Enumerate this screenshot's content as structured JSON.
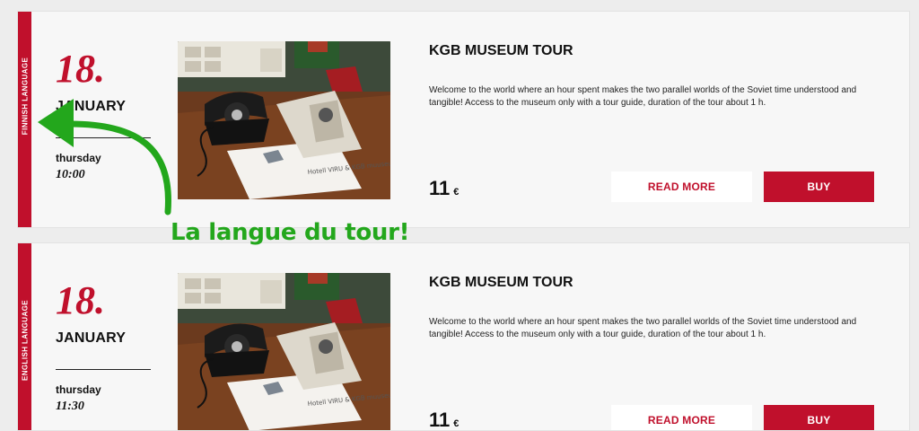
{
  "colors": {
    "accent": "#c0102c",
    "annotation": "#23a71c",
    "card_bg": "#f7f7f7"
  },
  "tours": [
    {
      "language": "FINNISH LANGUAGE",
      "day": "18.",
      "month": "JANUARY",
      "weekday": "thursday",
      "time": "10:00",
      "title": "KGB MUSEUM TOUR",
      "description": "Welcome to the world where an hour spent makes the two parallel worlds of the Soviet time understood and tangible! Access to the museum only with a tour guide, duration of the tour about 1 h.",
      "price": "11",
      "currency": "€",
      "read_more": "READ MORE",
      "buy": "BUY",
      "photo_caption": "Hotell VIRU & KGB muuseum"
    },
    {
      "language": "ENGLISH LANGUAGE",
      "day": "18.",
      "month": "JANUARY",
      "weekday": "thursday",
      "time": "11:30",
      "title": "KGB MUSEUM TOUR",
      "description": "Welcome to the world where an hour spent makes the two parallel worlds of the Soviet time understood and tangible! Access to the museum only with a tour guide, duration of the tour about 1 h.",
      "price": "11",
      "currency": "€",
      "read_more": "READ MORE",
      "buy": "BUY",
      "photo_caption": "Hotell VIRU & KGB muuseum"
    }
  ],
  "annotation": {
    "text": "La langue du tour!"
  }
}
